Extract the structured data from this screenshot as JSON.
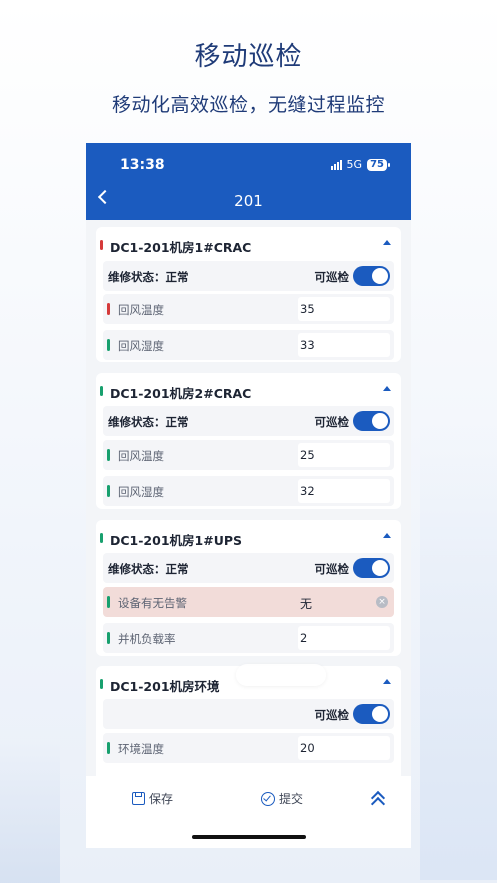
{
  "promo": {
    "title": "移动巡检",
    "subtitle": "移动化高效巡检，无缝过程监控"
  },
  "status_bar": {
    "time": "13:38",
    "network": "5G",
    "battery": "75"
  },
  "nav": {
    "title": "201"
  },
  "cards": [
    {
      "title": "DC1-201机房1#CRAC",
      "indicator_color": "#d53a3a",
      "state_label": "维修状态：正常",
      "toggle_label": "可巡检",
      "toggle_on": true,
      "fields": [
        {
          "label": "回风温度",
          "value": "35",
          "indicator_color": "#d53a3a"
        },
        {
          "label": "回风湿度",
          "value": "33",
          "indicator_color": "#18a06e"
        }
      ]
    },
    {
      "title": "DC1-201机房2#CRAC",
      "indicator_color": "#18a06e",
      "state_label": "维修状态：正常",
      "toggle_label": "可巡检",
      "toggle_on": true,
      "fields": [
        {
          "label": "回风温度",
          "value": "25",
          "indicator_color": "#18a06e"
        },
        {
          "label": "回风湿度",
          "value": "32",
          "indicator_color": "#18a06e"
        }
      ]
    },
    {
      "title": "DC1-201机房1#UPS",
      "indicator_color": "#18a06e",
      "state_label": "维修状态：正常",
      "toggle_label": "可巡检",
      "toggle_on": true,
      "fields": [
        {
          "label": "设备有无告警",
          "value": "无",
          "indicator_color": "#18a06e",
          "highlight": "#f2dcd9"
        },
        {
          "label": "并机负载率",
          "value": "2",
          "indicator_color": "#18a06e"
        }
      ]
    },
    {
      "title": "DC1-201机房环境",
      "indicator_color": "#18a06e",
      "state_label": "",
      "toggle_label": "可巡检",
      "toggle_on": true,
      "fields": [
        {
          "label": "环境温度",
          "value": "20",
          "indicator_color": "#18a06e"
        }
      ]
    }
  ],
  "toolbar": {
    "save_label": "保存",
    "submit_label": "提交"
  },
  "colors": {
    "primary": "#1b5bbf",
    "ok": "#18a06e",
    "warn": "#d53a3a",
    "alert_bg": "#f2dcd9"
  },
  "icons": [
    "back-icon",
    "signal-icon",
    "battery-icon",
    "collapse-caret-icon",
    "clear-icon",
    "save-icon",
    "submit-icon",
    "scroll-top-icon"
  ]
}
